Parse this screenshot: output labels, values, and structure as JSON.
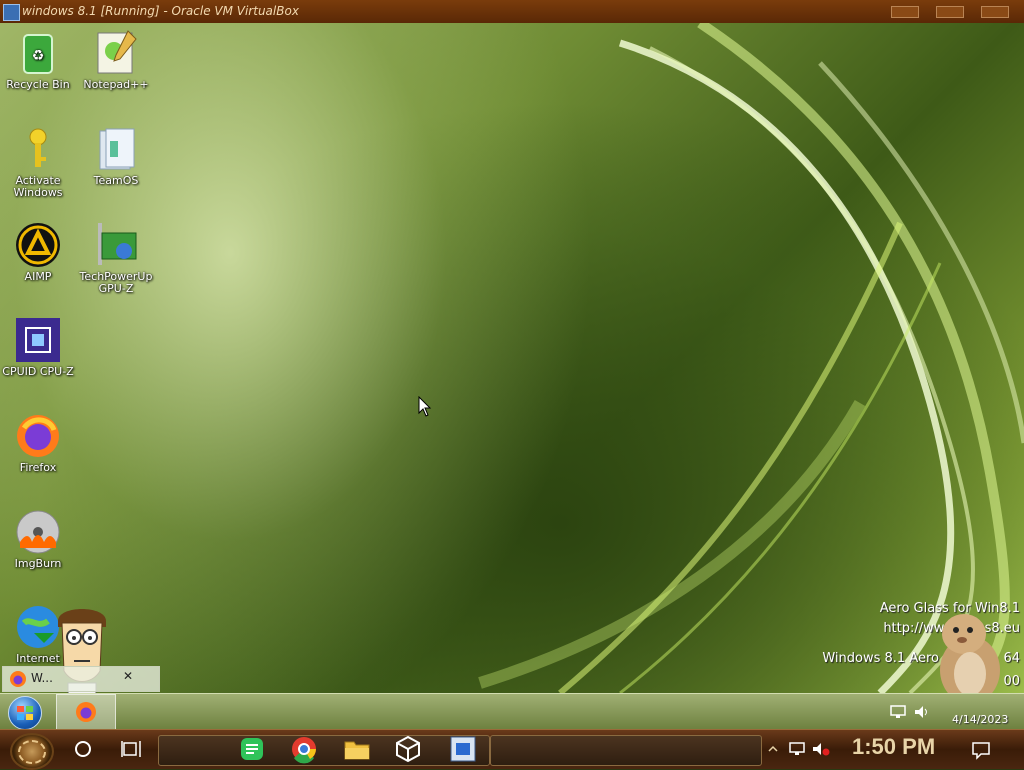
{
  "window": {
    "title": "windows 8.1 [Running] - Oracle VM VirtualBox"
  },
  "desktop_icons": [
    {
      "label": "Recycle Bin",
      "icon": "recycle-bin-icon"
    },
    {
      "label": "Notepad++",
      "icon": "notepad-plus-plus-icon"
    },
    {
      "label": "Activate Windows",
      "icon": "key-icon"
    },
    {
      "label": "TeamOS",
      "icon": "teamos-icon"
    },
    {
      "label": "AIMP",
      "icon": "aimp-icon"
    },
    {
      "label": "TechPowerUp GPU-Z",
      "icon": "gpu-z-icon"
    },
    {
      "label": "CPUID CPU-Z",
      "icon": "cpu-z-icon"
    },
    {
      "label": "Firefox",
      "icon": "firefox-icon"
    },
    {
      "label": "ImgBurn",
      "icon": "imgburn-icon"
    },
    {
      "label": "Internet",
      "icon": "internet-download-icon"
    }
  ],
  "watermark": {
    "line1": "Aero Glass for Win8.1",
    "line2": "http://www.glass8.eu",
    "line3": "Windows 8.1 Aero",
    "line3_tail": "64",
    "line4_tail": "00"
  },
  "thumbnail": {
    "label": "W...",
    "close": "✕"
  },
  "aero_taskbar": {
    "date": "4/14/2023"
  },
  "steam_taskbar": {
    "clock": "1:50 PM"
  },
  "colors": {
    "accent": "#5a2806",
    "desktop_green": "#6f8c34"
  }
}
